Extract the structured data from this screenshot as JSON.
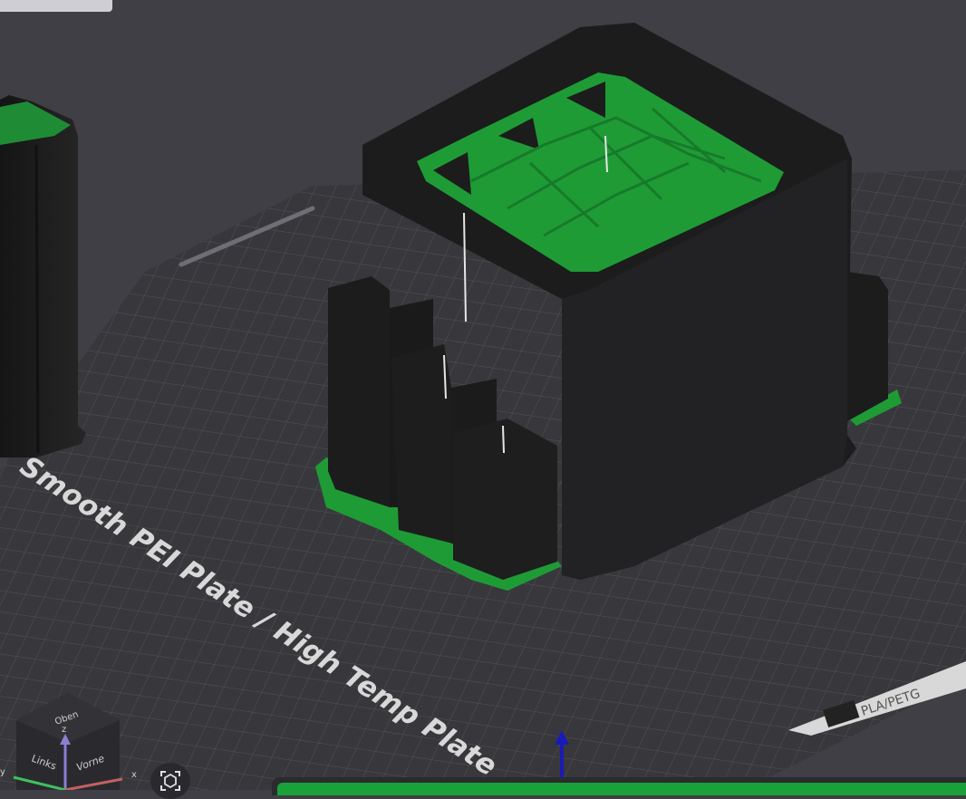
{
  "viewport": {
    "bed_label": "Smooth PEI Plate / High Temp Plate",
    "bed_badge": "PLA/PETG"
  },
  "view_cube": {
    "top": "Oben",
    "left": "Links",
    "front": "Vorne",
    "axis_x": "x",
    "axis_y": "y",
    "axis_z": "z"
  },
  "colors": {
    "background": "#3f3f45",
    "bed": "#3a3a3e",
    "model_black": "#1c1c1c",
    "model_green": "#1f9b36",
    "axis_blue": "#1a1ab8"
  },
  "icons": {
    "camera_reset": "view-fit-icon"
  }
}
